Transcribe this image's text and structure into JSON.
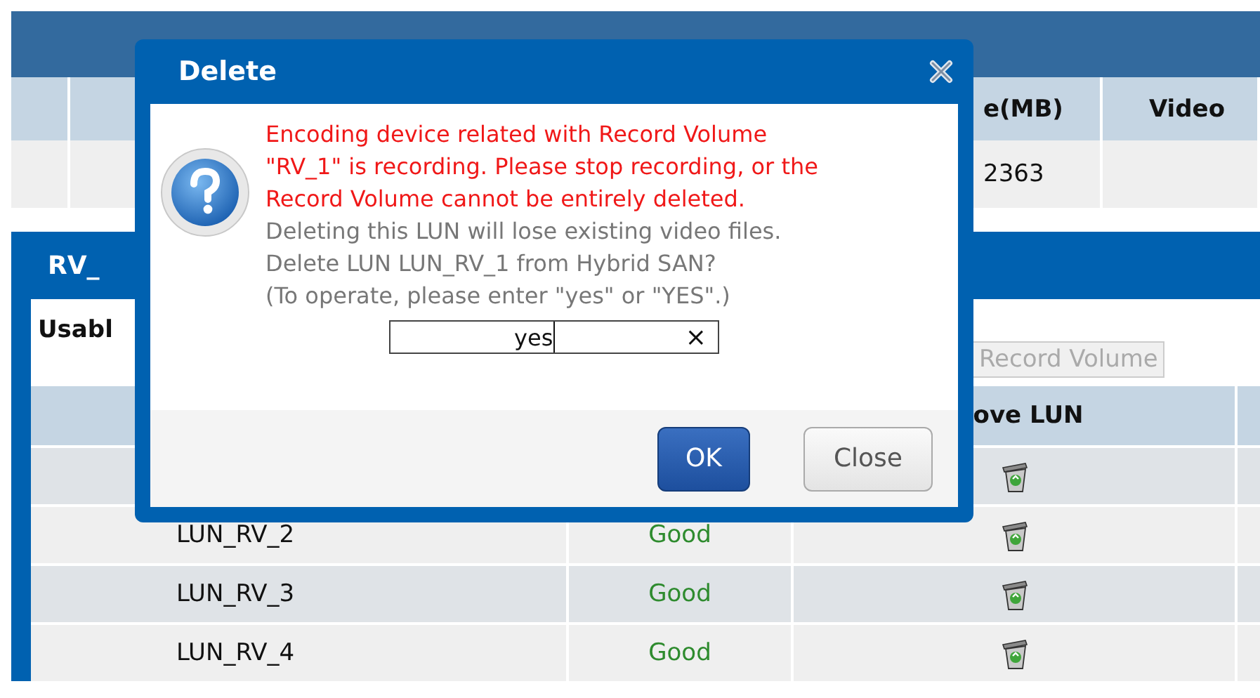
{
  "top_table": {
    "columns": [
      "e(MB)",
      "Video"
    ],
    "rows": [
      {
        "cell": "2363"
      }
    ]
  },
  "volume_panel": {
    "title": "RV_",
    "usable_label": "Usabl",
    "record_volume_button": {
      "label": "Record Volume",
      "disabled": true
    },
    "table": {
      "columns": [
        "ove LUN"
      ],
      "rows": [
        {
          "kind": "covered"
        },
        {
          "kind": "lun",
          "name": "LUN_RV_2",
          "status": "Good"
        },
        {
          "kind": "lun",
          "name": "LUN_RV_3",
          "status": "Good"
        },
        {
          "kind": "lun",
          "name": "LUN_RV_4",
          "status": "Good"
        }
      ]
    }
  },
  "dialog": {
    "title": "Delete",
    "warning_lines": [
      "Encoding device related with Record Volume",
      "\"RV_1\" is recording. Please stop recording, or the",
      "Record Volume cannot be entirely deleted."
    ],
    "message_lines": [
      "Deleting this LUN will lose existing video files.",
      "Delete LUN LUN_RV_1 from Hybrid SAN?",
      "(To operate, please enter \"yes\" or \"YES\".)"
    ],
    "input": {
      "value": "yes",
      "clear_symbol": "×"
    },
    "buttons": [
      {
        "label": "OK",
        "kind": "primary"
      },
      {
        "label": "Close",
        "kind": "secondary"
      }
    ]
  }
}
